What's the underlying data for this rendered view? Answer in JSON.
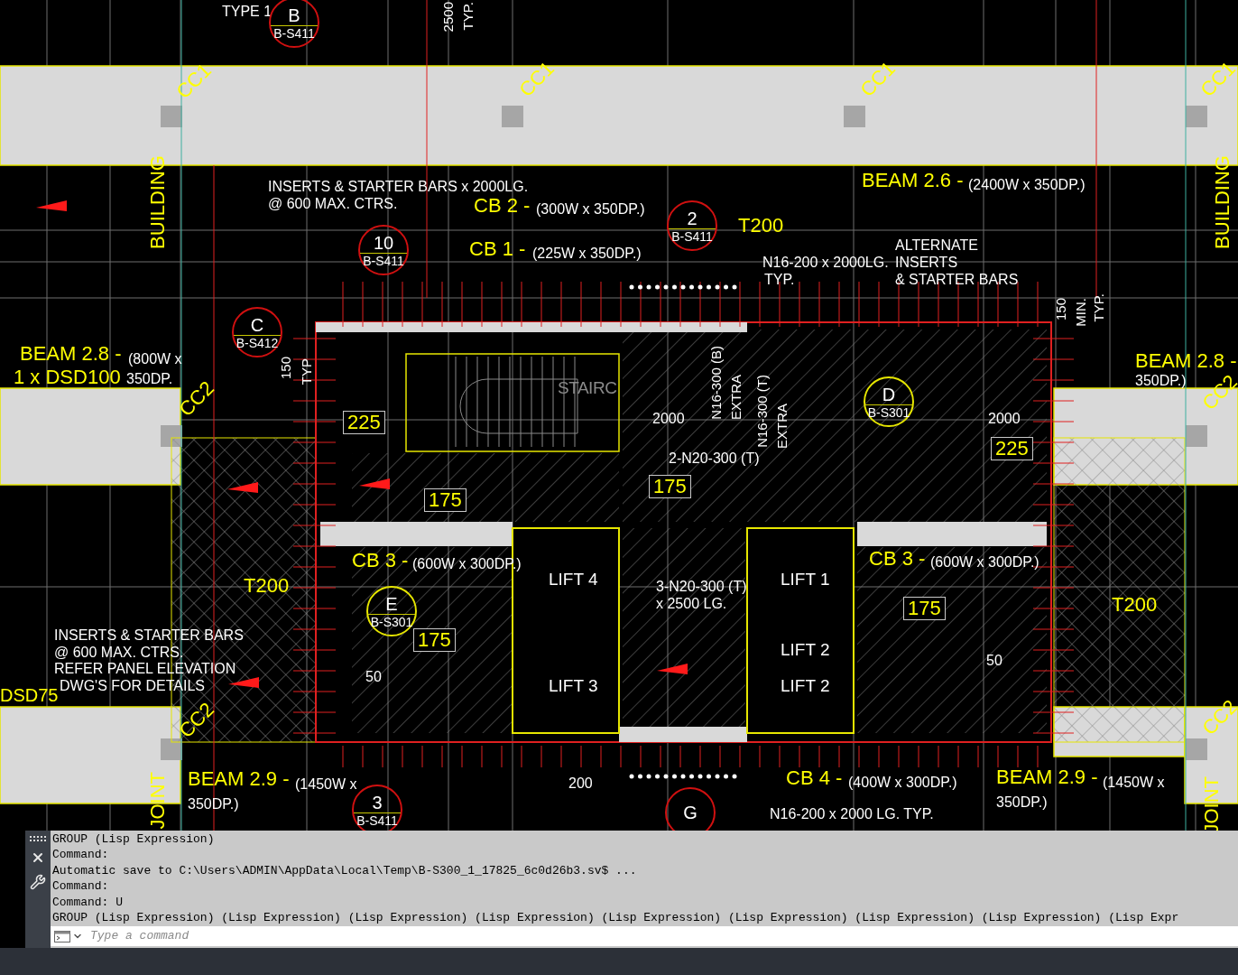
{
  "drawing": {
    "labels": [
      {
        "kind": "note",
        "text": "TYPE 1"
      },
      {
        "kind": "vnote",
        "text": "2500"
      },
      {
        "kind": "vnote",
        "text": "TYP."
      },
      {
        "kind": "column",
        "text": "CC1"
      },
      {
        "kind": "column",
        "text": "CC1"
      },
      {
        "kind": "column",
        "text": "CC1"
      },
      {
        "kind": "column",
        "text": "CC1"
      },
      {
        "kind": "vheading",
        "text": "BUILDING"
      },
      {
        "kind": "vheading",
        "text": "BUILDING"
      },
      {
        "kind": "note",
        "text": "INSERTS & STARTER BARS x 2000LG."
      },
      {
        "kind": "heading",
        "text": "BEAM 2.6 -"
      },
      {
        "kind": "note",
        "text": "(2400W x 350DP.)"
      },
      {
        "kind": "note",
        "text": "@ 600 MAX. CTRS."
      },
      {
        "kind": "heading",
        "text": "CB 2 -"
      },
      {
        "kind": "note",
        "text": "(300W x 350DP.)"
      },
      {
        "kind": "heading",
        "text": "T200"
      },
      {
        "kind": "note",
        "text": "ALTERNATE"
      },
      {
        "kind": "heading",
        "text": "CB 1 -"
      },
      {
        "kind": "note",
        "text": "(225W x 350DP.)"
      },
      {
        "kind": "note",
        "text": "N16-200 x 2000LG."
      },
      {
        "kind": "note",
        "text": "INSERTS"
      },
      {
        "kind": "note",
        "text": "TYP."
      },
      {
        "kind": "note",
        "text": "& STARTER BARS"
      },
      {
        "kind": "vnote",
        "text": "150"
      },
      {
        "kind": "vnote",
        "text": "MIN."
      },
      {
        "kind": "vnote",
        "text": "TYP."
      },
      {
        "kind": "heading",
        "text": "BEAM 2.8 -"
      },
      {
        "kind": "note",
        "text": "(800W x"
      },
      {
        "kind": "heading",
        "text": "1 x DSD100"
      },
      {
        "kind": "note",
        "text": "350DP."
      },
      {
        "kind": "heading",
        "text": "BEAM 2.8 -"
      },
      {
        "kind": "note",
        "text": "350DP.)"
      },
      {
        "kind": "vnote",
        "text": "150"
      },
      {
        "kind": "vnote",
        "text": "TYP"
      },
      {
        "kind": "ghost",
        "text": "STAIRC"
      },
      {
        "kind": "vnote",
        "text": "N16-300 (B)"
      },
      {
        "kind": "vnote",
        "text": "EXTRA"
      },
      {
        "kind": "vnote",
        "text": "N16-300 (T)"
      },
      {
        "kind": "vnote",
        "text": "EXTRA"
      },
      {
        "kind": "column",
        "text": "CC2"
      },
      {
        "kind": "column",
        "text": "CC2"
      },
      {
        "kind": "tag",
        "text": "225"
      },
      {
        "kind": "note",
        "text": "2000"
      },
      {
        "kind": "note",
        "text": "2000"
      },
      {
        "kind": "tag",
        "text": "225"
      },
      {
        "kind": "note",
        "text": "2-N20-300 (T)"
      },
      {
        "kind": "tag",
        "text": "175"
      },
      {
        "kind": "tag",
        "text": "175"
      },
      {
        "kind": "heading",
        "text": "CB 3 -"
      },
      {
        "kind": "note",
        "text": "(600W x 300DP.)"
      },
      {
        "kind": "heading",
        "text": "CB 3 -"
      },
      {
        "kind": "note",
        "text": "(600W x 300DP.)"
      },
      {
        "kind": "lift",
        "text": "LIFT 4"
      },
      {
        "kind": "lift",
        "text": "LIFT 1"
      },
      {
        "kind": "note",
        "text": "3-N20-300 (T)"
      },
      {
        "kind": "heading",
        "text": "T200"
      },
      {
        "kind": "note",
        "text": "x 2500 LG."
      },
      {
        "kind": "tag",
        "text": "175"
      },
      {
        "kind": "heading",
        "text": "T200"
      },
      {
        "kind": "note",
        "text": "INSERTS & STARTER BARS"
      },
      {
        "kind": "tag",
        "text": "175"
      },
      {
        "kind": "note",
        "text": "@ 600 MAX. CTRS."
      },
      {
        "kind": "lift",
        "text": "LIFT 2"
      },
      {
        "kind": "note",
        "text": "50"
      },
      {
        "kind": "note",
        "text": "REFER PANEL ELEVATION"
      },
      {
        "kind": "note",
        "text": "50"
      },
      {
        "kind": "note",
        "text": "DWG'S FOR DETAILS"
      },
      {
        "kind": "lift",
        "text": "LIFT 3"
      },
      {
        "kind": "lift",
        "text": "LIFT 2"
      },
      {
        "kind": "mark",
        "text": "DSD75"
      },
      {
        "kind": "column",
        "text": "CC2"
      },
      {
        "kind": "column",
        "text": "CC2"
      },
      {
        "kind": "heading",
        "text": "BEAM 2.9 -"
      },
      {
        "kind": "note",
        "text": "(1450W x"
      },
      {
        "kind": "note",
        "text": "200"
      },
      {
        "kind": "heading",
        "text": "CB 4 -"
      },
      {
        "kind": "note",
        "text": "(400W x 300DP.)"
      },
      {
        "kind": "heading",
        "text": "BEAM 2.9 -"
      },
      {
        "kind": "note",
        "text": "(1450W x"
      },
      {
        "kind": "vheading",
        "text": "JOINT"
      },
      {
        "kind": "vheading",
        "text": "JOINT"
      },
      {
        "kind": "note",
        "text": "350DP.)"
      },
      {
        "kind": "note",
        "text": "350DP.)"
      },
      {
        "kind": "note",
        "text": "N16-200 x 2000 LG. TYP."
      }
    ],
    "callouts": [
      {
        "mark": "B",
        "sheet": "B-S411",
        "color": "#d01010"
      },
      {
        "mark": "2",
        "sheet": "B-S411",
        "color": "#d01010"
      },
      {
        "mark": "10",
        "sheet": "B-S411",
        "color": "#d01010"
      },
      {
        "mark": "C",
        "sheet": "B-S412",
        "color": "#d01010"
      },
      {
        "mark": "D",
        "sheet": "B-S301",
        "color": "#e6e600"
      },
      {
        "mark": "E",
        "sheet": "B-S301",
        "color": "#e6e600"
      },
      {
        "mark": "3",
        "sheet": "B-S411",
        "color": "#d01010"
      },
      {
        "mark": "G",
        "color": "#d01010"
      }
    ]
  },
  "command_line": {
    "history": [
      "GROUP (Lisp Expression)",
      "Command:",
      "Automatic save to C:\\Users\\ADMIN\\AppData\\Local\\Temp\\B-S300_1_17825_6c0d26b3.sv$ ...",
      "Command:",
      "Command: U",
      "GROUP (Lisp Expression) (Lisp Expression) (Lisp Expression) (Lisp Expression) (Lisp Expression) (Lisp Expression) (Lisp Expression) (Lisp Expression) (Lisp Expr"
    ],
    "placeholder": "Type a command"
  }
}
